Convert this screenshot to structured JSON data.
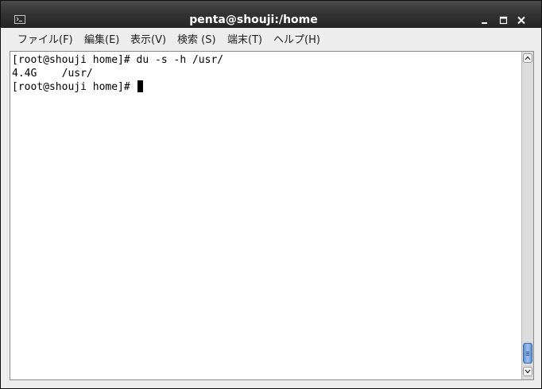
{
  "window": {
    "title": "penta@shouji:/home",
    "app_icon": "terminal-icon",
    "buttons": [
      "minimize-icon",
      "maximize-icon",
      "close-icon"
    ]
  },
  "menubar": {
    "items": [
      {
        "label": "ファイル(F)"
      },
      {
        "label": "編集(E)"
      },
      {
        "label": "表示(V)"
      },
      {
        "label": "検索 (S)"
      },
      {
        "label": "端末(T)"
      },
      {
        "label": "ヘルプ(H)"
      }
    ]
  },
  "terminal": {
    "lines": [
      "[root@shouji home]# du -s -h /usr/",
      "4.4G\t/usr/",
      "[root@shouji home]# "
    ],
    "prompt_cursor": "block-cursor"
  },
  "colors": {
    "titlebar": "#333333",
    "menubar": "#ededed",
    "terminal_bg": "#ffffff",
    "terminal_fg": "#000000",
    "scrollbar_thumb": "#6f9ed8"
  }
}
